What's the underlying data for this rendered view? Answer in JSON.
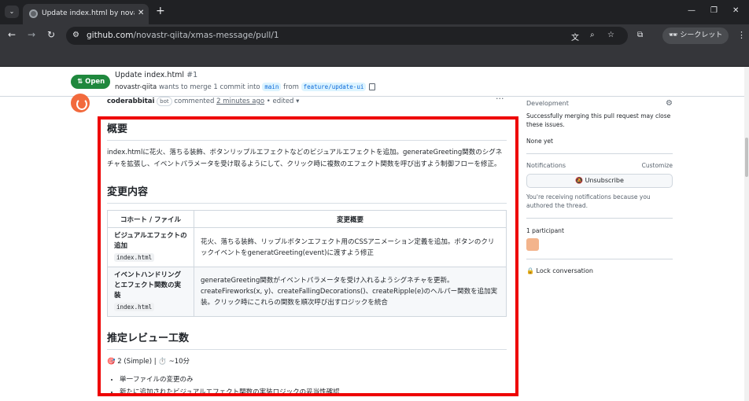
{
  "browser": {
    "tab_title": "Update index.html by novastr",
    "tab_close": "✕",
    "new_tab": "+",
    "url_host": "github.com",
    "url_path": "/novastr-qiita/xmas-message/pull/1",
    "incognito_label": "シークレット",
    "window_controls": [
      "—",
      "❐",
      "✕"
    ]
  },
  "pr": {
    "state": "Open",
    "title": "Update index.html",
    "number": "#1",
    "author": "novastr-qiita",
    "meta_middle": " wants to merge 1 commit into ",
    "base_branch": "main",
    "from_word": " from ",
    "head_branch": "feature/update-ui"
  },
  "comment": {
    "author": "coderabbitai",
    "bot_label": "bot",
    "commented_word": " commented ",
    "time": "2 minutes ago",
    "edited": " • edited ▾",
    "more": "···"
  },
  "body": {
    "h_overview": "概要",
    "overview": "index.htmlに花火、落ちる装飾、ボタンリップルエフェクトなどのビジュアルエフェクトを追加。generateGreeting関数のシグネチャを拡張し、イベントパラメータを受け取るようにして、クリック時に複数のエフェクト関数を呼び出すよう制御フローを修正。",
    "h_changes": "変更内容",
    "table_headers": [
      "コホート / ファイル",
      "変更概要"
    ],
    "rows": [
      {
        "cohort": "ビジュアルエフェクトの追加",
        "file": "index.html",
        "summary": "花火、落ちる装飾、リップルボタンエフェクト用のCSSアニメーション定義を追加。ボタンのクリックイベントをgeneratGreeting(event)に渡すよう修正"
      },
      {
        "cohort": "イベントハンドリングとエフェクト関数の実装",
        "file": "index.html",
        "summary": "generateGreeting関数がイベントパラメータを受け入れるようシグネチャを更新。createFireworks(x, y)、createFallingDecorations()、createRipple(e)のヘルパー関数を追加実装。クリック時にこれらの関数を順次呼び出すロジックを統合"
      }
    ],
    "h_effort": "推定レビュー工数",
    "effort_line": "🎯 2 (Simple) | ⏱️ ~10分",
    "bullets": [
      "単一ファイルの変更のみ",
      "新たに追加されたビジュアルエフェクト関数の実装ロジックの妥当性確認"
    ]
  },
  "sidebar": {
    "development_title": "Development",
    "development_text": "Successfully merging this pull request may close these issues.",
    "none_yet": "None yet",
    "notifications_title": "Notifications",
    "customize": "Customize",
    "unsubscribe": "🔕 Unsubscribe",
    "notify_reason": "You're receiving notifications because you authored the thread.",
    "participants": "1 participant",
    "lock": "🔒 Lock conversation"
  }
}
